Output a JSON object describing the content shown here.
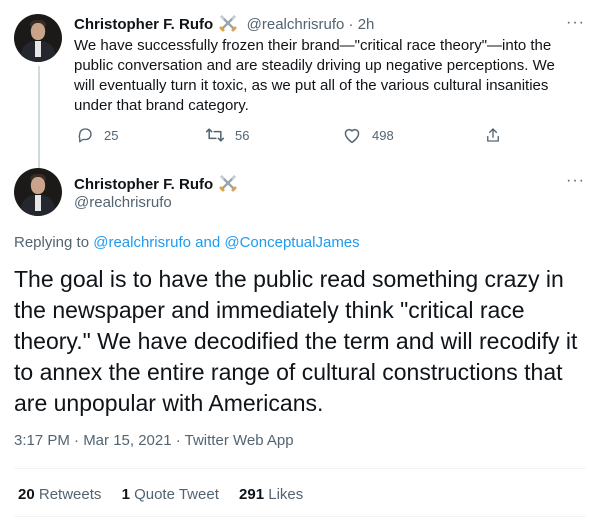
{
  "tweet1": {
    "name": "Christopher F. Rufo",
    "handle_time": "@realchrisrufo · 2h",
    "text": "We have successfully frozen their brand—\"critical race theory\"—into the public conversation and are steadily driving up negative perceptions. We will eventually turn it toxic, as we put all of the various cultural insanities under that brand category.",
    "replies": "25",
    "retweets": "56",
    "likes": "498",
    "more": "···"
  },
  "tweet2": {
    "name": "Christopher F. Rufo",
    "handle": "@realchrisrufo",
    "more": "···",
    "replying_prefix": "Replying to ",
    "replying_user1": "@realchrisrufo",
    "replying_and": " and ",
    "replying_user2": "@ConceptualJames",
    "text": "The goal is to have the public read something crazy in the newspaper and immediately think \"critical race theory.\" We have decodified the term and will recodify it to annex the entire range of cultural constructions that are unpopular with Americans.",
    "timestamp": "3:17 PM · Mar 15, 2021 · ",
    "source": "Twitter Web App",
    "retweets_count": "20",
    "retweets_label": "Retweets",
    "quotes_count": "1",
    "quotes_label": "Quote Tweet",
    "likes_count": "291",
    "likes_label": "Likes"
  },
  "icons": [
    "swords-emoji-icon",
    "reply-icon",
    "retweet-icon",
    "like-icon",
    "share-icon",
    "more-icon"
  ],
  "colors": {
    "link": "#1d9bf0",
    "secondary": "#536471",
    "text": "#0f1419"
  }
}
